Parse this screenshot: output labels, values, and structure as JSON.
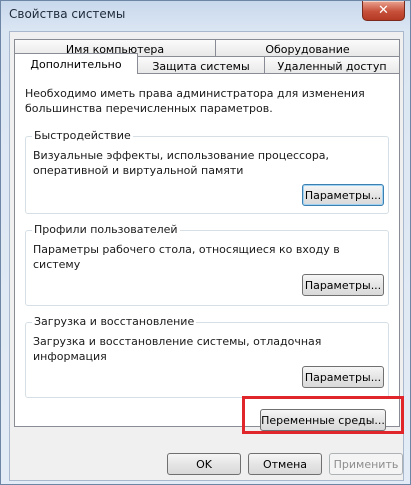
{
  "window": {
    "title": "Свойства системы",
    "close_glyph": "✕"
  },
  "tabs": {
    "row_back": [
      "Имя компьютера",
      "Оборудование"
    ],
    "row_front": [
      "Дополнительно",
      "Защита системы",
      "Удаленный доступ"
    ],
    "selected": "Дополнительно"
  },
  "panel": {
    "note": "Необходимо иметь права администратора для изменения большинства перечисленных параметров.",
    "groups": [
      {
        "title": "Быстродействие",
        "description": "Визуальные эффекты, использование процессора, оперативной и виртуальной памяти",
        "button": "Параметры..."
      },
      {
        "title": "Профили пользователей",
        "description": "Параметры рабочего стола, относящиеся ко входу в систему",
        "button": "Параметры..."
      },
      {
        "title": "Загрузка и восстановление",
        "description": "Загрузка и восстановление системы, отладочная информация",
        "button": "Параметры..."
      }
    ],
    "env_button": "Переменные среды..."
  },
  "footer": {
    "ok": "OK",
    "cancel": "Отмена",
    "apply": "Применить"
  },
  "colors": {
    "highlight": "#e0262b",
    "close": "#c7503a"
  }
}
